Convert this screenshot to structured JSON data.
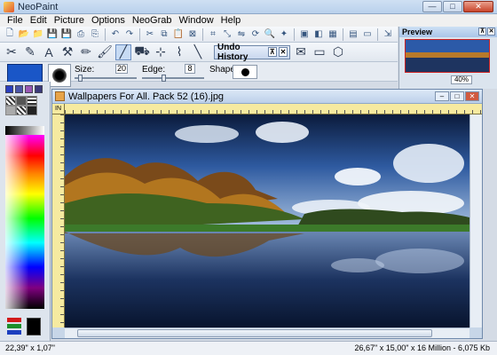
{
  "window": {
    "title": "NeoPaint",
    "minimize": "—",
    "maximize": "□",
    "close": "✕"
  },
  "menu": [
    "File",
    "Edit",
    "Picture",
    "Options",
    "NeoGrab",
    "Window",
    "Help"
  ],
  "undo_panel": {
    "label": "Undo History",
    "pin": "⊼",
    "close": "✕"
  },
  "options": {
    "size_label": "Size:",
    "size_value": "20",
    "edge_label": "Edge:",
    "edge_value": "8",
    "shape_label": "Shape:"
  },
  "preview": {
    "title": "Preview",
    "pin": "⊼",
    "close": "✕",
    "zoom": "40%"
  },
  "document": {
    "title": "Wallpapers For All. Pack 52 (16).jpg",
    "units": "IN",
    "minimize": "–",
    "maximize": "□",
    "close": "✕"
  },
  "status": {
    "cursor": "22,39\" x 1,07\"",
    "info": "26,67\" x 15,00\" x 16 Million - 6,075 Kb"
  }
}
